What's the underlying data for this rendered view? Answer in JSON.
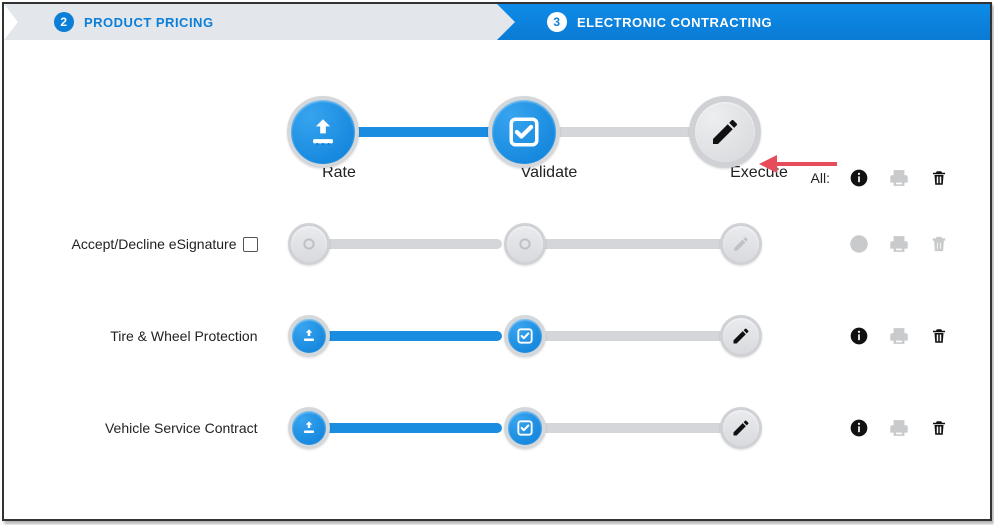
{
  "stepper": {
    "step2": {
      "num": "2",
      "label": "PRODUCT PRICING"
    },
    "step3": {
      "num": "3",
      "label": "ELECTRONIC CONTRACTING"
    }
  },
  "columns": {
    "rate": "Rate",
    "validate": "Validate",
    "execute": "Execute"
  },
  "all_label": "All:",
  "rows": [
    {
      "label": "Accept/Decline eSignature",
      "has_checkbox": true
    },
    {
      "label": "Tire & Wheel Protection"
    },
    {
      "label": "Vehicle Service Contract"
    }
  ]
}
